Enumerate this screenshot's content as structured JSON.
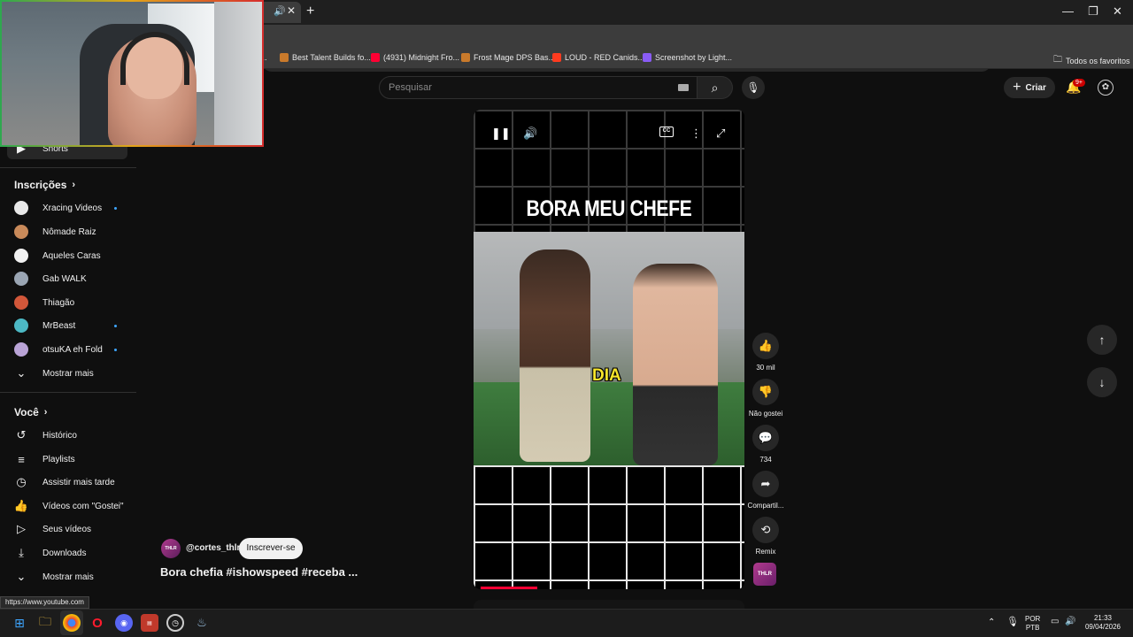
{
  "browser": {
    "tab_audio_icon": "speaker-icon",
    "tab_close": "✕",
    "new_tab": "+",
    "window_controls": [
      "—",
      "❐",
      "✕"
    ],
    "bookmarks": [
      {
        "label": "Best Talent Builds fo...",
        "color": "#c97a2b"
      },
      {
        "label": "(4931) Midnight Fro...",
        "color": "#ff0033"
      },
      {
        "label": "Frost Mage DPS Bas...",
        "color": "#c97a2b"
      },
      {
        "label": "LOUD - RED Canids...",
        "color": "#ff3b1f"
      },
      {
        "label": "Screenshot by Light...",
        "color": "#8a5cf6"
      }
    ],
    "all_bookmarks": "Todos os favoritos",
    "status_url": "https://www.youtube.com"
  },
  "header": {
    "search_placeholder": "Pesquisar",
    "create_label": "Criar",
    "notifications_badge": "9+"
  },
  "sidebar": {
    "shorts_label": "Shorts",
    "subscriptions_heading": "Inscrições",
    "subscriptions": [
      {
        "label": "Xracing Videos",
        "color": "#e8e8e8",
        "dot": true
      },
      {
        "label": "Nômade Raiz",
        "color": "#c98a5a",
        "dot": false
      },
      {
        "label": "Aqueles Caras",
        "color": "#f1f1f1",
        "dot": false
      },
      {
        "label": "Gab WALK",
        "color": "#9aa5b3",
        "dot": false
      },
      {
        "label": "Thiagão",
        "color": "#d2573a",
        "dot": false
      },
      {
        "label": "MrBeast",
        "color": "#4cb8c4",
        "dot": true
      },
      {
        "label": "otsuKA eh Fold",
        "color": "#b9a3d6",
        "dot": true
      }
    ],
    "show_more_1": "Mostrar mais",
    "you_heading": "Você",
    "you_items": [
      {
        "label": "Histórico",
        "icon": "history-icon"
      },
      {
        "label": "Playlists",
        "icon": "playlist-icon"
      },
      {
        "label": "Assistir mais tarde",
        "icon": "clock-icon"
      },
      {
        "label": "Vídeos com \"Gostei\"",
        "icon": "thumb-up-icon"
      },
      {
        "label": "Seus vídeos",
        "icon": "play-square-icon"
      },
      {
        "label": "Downloads",
        "icon": "download-icon"
      }
    ],
    "show_more_2": "Mostrar mais"
  },
  "player": {
    "title_text": "BORA MEU CHEFE",
    "caption_word": "DIA",
    "progress": 0.22
  },
  "actions": {
    "likes": "30 mil",
    "dislike": "Não gostei",
    "comments": "734",
    "share": "Compartil...",
    "remix": "Remix"
  },
  "video": {
    "channel_handle": "@cortes_thlr",
    "channel_avatar_text": "THLR",
    "subscribe_label": "Inscrever-se",
    "title": "Bora chefia #ishowspeed #receba ..."
  },
  "taskbar": {
    "language": "POR",
    "layout": "PTB",
    "time": "21:33",
    "date": "09/04/2026"
  }
}
